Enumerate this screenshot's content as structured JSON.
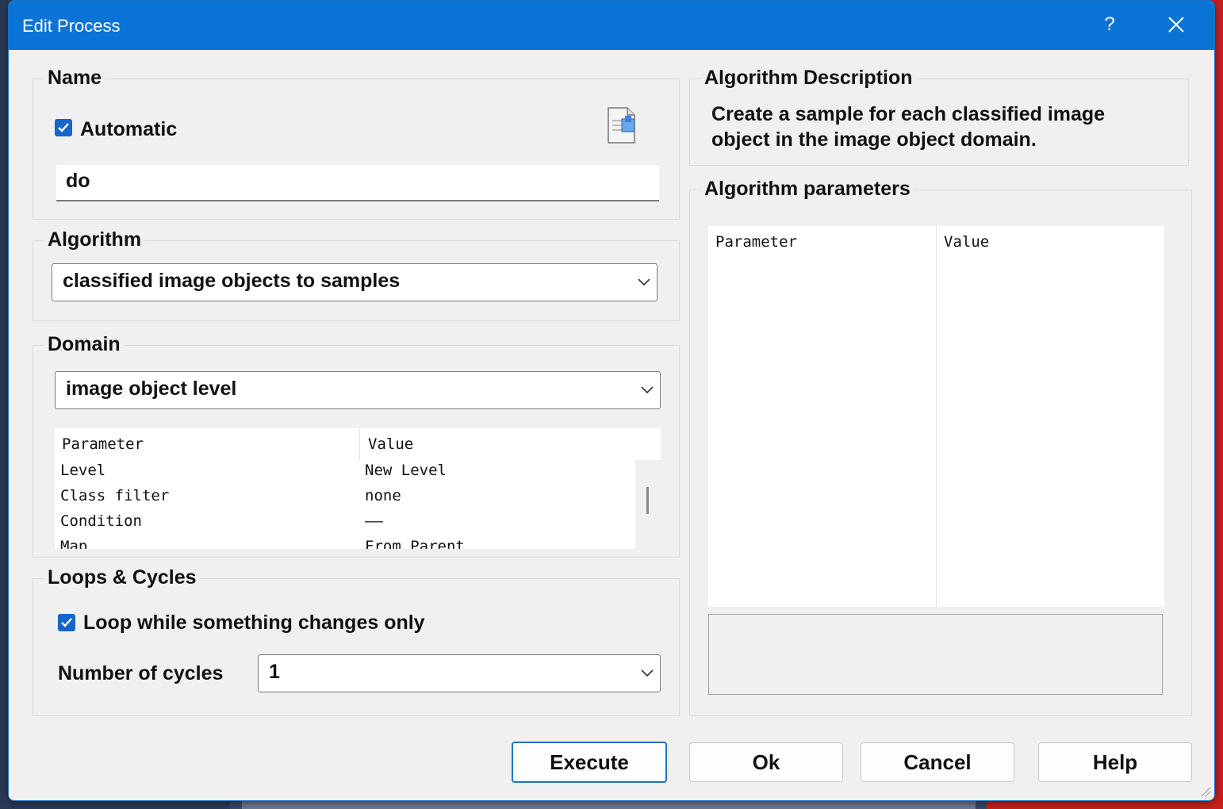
{
  "window": {
    "title": "Edit Process",
    "help_glyph": "?",
    "close_icon": "close-icon"
  },
  "name_group": {
    "label": "Name",
    "automatic_label": "Automatic",
    "automatic_checked": true,
    "name_value": "do",
    "edit_icon": "document-edit-icon"
  },
  "algorithm_group": {
    "label": "Algorithm",
    "selected": "classified image objects to samples"
  },
  "domain_group": {
    "label": "Domain",
    "selected": "image object level",
    "table": {
      "headers": [
        "Parameter",
        "Value"
      ],
      "rows": [
        {
          "parameter": "Level",
          "value": "New Level"
        },
        {
          "parameter": "Class filter",
          "value": "none"
        },
        {
          "parameter": "Condition",
          "value": "——"
        },
        {
          "parameter": "Map",
          "value": "From Parent"
        }
      ]
    }
  },
  "loops_group": {
    "label": "Loops & Cycles",
    "loop_label": "Loop while something changes only",
    "loop_checked": true,
    "cycles_label": "Number of cycles",
    "cycles_value": "1"
  },
  "description_group": {
    "label": "Algorithm Description",
    "text_line1": "Create a sample for each classified image",
    "text_line2": "object in the image object domain."
  },
  "parameters_group": {
    "label": "Algorithm parameters",
    "headers": [
      "Parameter",
      "Value"
    ]
  },
  "buttons": {
    "execute": "Execute",
    "ok": "Ok",
    "cancel": "Cancel",
    "help": "Help"
  },
  "colors": {
    "titlebar": "#0a74d6",
    "checkbox": "#1466c9",
    "accent_border": "#1f73c9"
  }
}
